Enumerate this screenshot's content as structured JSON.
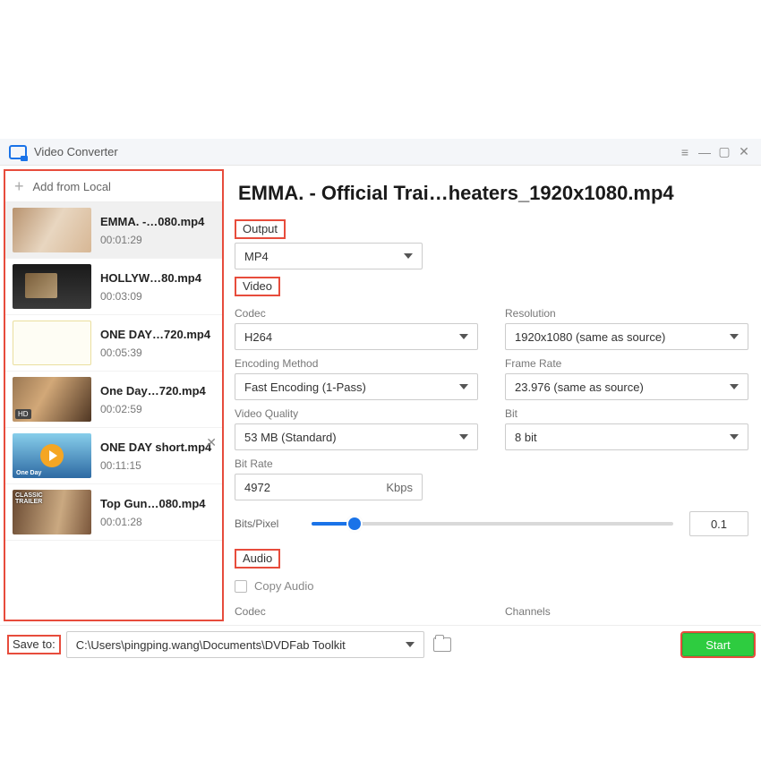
{
  "titlebar": {
    "title": "Video Converter"
  },
  "sidebar": {
    "add_label": "Add from Local",
    "items": [
      {
        "name": "EMMA. -…080.mp4",
        "time": "00:01:29"
      },
      {
        "name": "HOLLYW…80.mp4",
        "time": "00:03:09"
      },
      {
        "name": "ONE DAY…720.mp4",
        "time": "00:05:39"
      },
      {
        "name": "One Day…720.mp4",
        "time": "00:02:59"
      },
      {
        "name": "ONE DAY short.mp4",
        "time": "00:11:15"
      },
      {
        "name": "Top Gun…080.mp4",
        "time": "00:01:28"
      }
    ]
  },
  "main": {
    "title": "EMMA. - Official Trai…heaters_1920x1080.mp4",
    "output_section": "Output",
    "output_format": "MP4",
    "video_section": "Video",
    "codec_label": "Codec",
    "codec": "H264",
    "resolution_label": "Resolution",
    "resolution": "1920x1080 (same as source)",
    "encoding_label": "Encoding Method",
    "encoding": "Fast Encoding (1-Pass)",
    "framerate_label": "Frame Rate",
    "framerate": "23.976 (same as source)",
    "quality_label": "Video Quality",
    "quality": "53 MB (Standard)",
    "bit_label": "Bit",
    "bit": "8 bit",
    "bitrate_label": "Bit Rate",
    "bitrate_value": "4972",
    "bitrate_unit": "Kbps",
    "bpp_label": "Bits/Pixel",
    "bpp_value": "0.1",
    "audio_section": "Audio",
    "copy_audio": "Copy Audio",
    "audio_codec_label": "Codec",
    "channels_label": "Channels"
  },
  "footer": {
    "save_to": "Save to:",
    "path": "C:\\Users\\pingping.wang\\Documents\\DVDFab Toolkit",
    "start": "Start"
  }
}
